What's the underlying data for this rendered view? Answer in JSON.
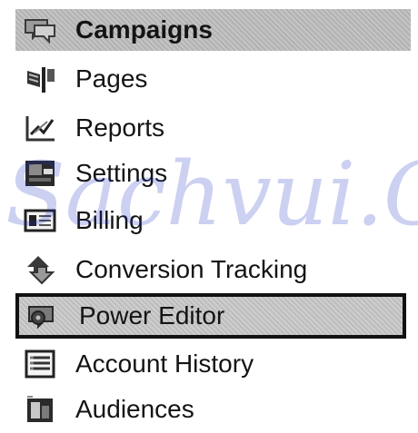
{
  "menu": {
    "items": [
      {
        "label": "Campaigns",
        "icon": "campaigns-icon"
      },
      {
        "label": "Pages",
        "icon": "pages-flag-icon"
      },
      {
        "label": "Reports",
        "icon": "reports-chart-icon"
      },
      {
        "label": "Settings",
        "icon": "settings-icon"
      },
      {
        "label": "Billing",
        "icon": "billing-card-icon"
      },
      {
        "label": "Conversion Tracking",
        "icon": "conversion-tracking-icon"
      },
      {
        "label": "Power Editor",
        "icon": "power-editor-icon"
      },
      {
        "label": "Account History",
        "icon": "account-history-icon"
      },
      {
        "label": "Audiences",
        "icon": "audiences-icon"
      }
    ],
    "active_item": "Campaigns",
    "selected_item": "Power Editor"
  },
  "watermark": "Sachvui.C",
  "colors": {
    "active_bg": "#bcbcbc",
    "selected_border": "#111111",
    "watermark": "#1a2dc4"
  }
}
